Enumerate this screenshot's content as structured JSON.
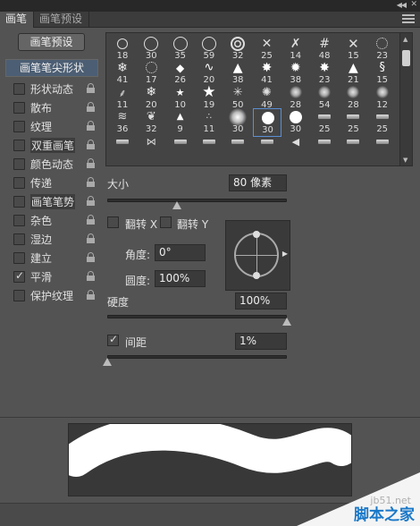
{
  "panel": {
    "tabs": [
      {
        "label": "画笔",
        "active": true
      },
      {
        "label": "画笔预设",
        "active": false
      }
    ],
    "preset_button": "画笔预设"
  },
  "sidebar": {
    "header": "画笔笔尖形状",
    "items": [
      {
        "label": "形状动态",
        "checked": false,
        "locked": true
      },
      {
        "label": "散布",
        "checked": false,
        "locked": true
      },
      {
        "label": "纹理",
        "checked": false,
        "locked": true
      },
      {
        "label": "双重画笔",
        "checked": false,
        "locked": true
      },
      {
        "label": "颜色动态",
        "checked": false,
        "locked": true
      },
      {
        "label": "传递",
        "checked": false,
        "locked": true
      },
      {
        "label": "画笔笔势",
        "checked": false,
        "locked": true
      },
      {
        "label": "杂色",
        "checked": false,
        "locked": true
      },
      {
        "label": "湿边",
        "checked": false,
        "locked": true
      },
      {
        "label": "建立",
        "checked": false,
        "locked": true
      },
      {
        "label": "平滑",
        "checked": true,
        "locked": true
      },
      {
        "label": "保护纹理",
        "checked": false,
        "locked": true
      }
    ]
  },
  "brush_grid": {
    "rows": [
      [
        {
          "size": "18",
          "icon": "ring"
        },
        {
          "size": "30",
          "icon": "ring"
        },
        {
          "size": "35",
          "icon": "ring"
        },
        {
          "size": "59",
          "icon": "ring"
        },
        {
          "size": "32",
          "icon": "double-ring"
        },
        {
          "size": "25",
          "icon": "cross"
        },
        {
          "size": "14",
          "icon": "hatch"
        },
        {
          "size": "48",
          "icon": "grid"
        },
        {
          "size": "15",
          "icon": "x-mark"
        },
        {
          "size": "23",
          "icon": "dotted-ring"
        }
      ],
      [
        {
          "size": "41",
          "icon": "snowflake"
        },
        {
          "size": "17",
          "icon": "dotted-ring"
        },
        {
          "size": "26",
          "icon": "diamond"
        },
        {
          "size": "20",
          "icon": "wave"
        },
        {
          "size": "38",
          "icon": "spike"
        },
        {
          "size": "41",
          "icon": "burst"
        },
        {
          "size": "38",
          "icon": "splat"
        },
        {
          "size": "23",
          "icon": "burst"
        },
        {
          "size": "21",
          "icon": "spike"
        },
        {
          "size": "15",
          "icon": "swirl"
        }
      ],
      [
        {
          "size": "11",
          "icon": "twig"
        },
        {
          "size": "20",
          "icon": "snowflake"
        },
        {
          "size": "10",
          "icon": "star"
        },
        {
          "size": "19",
          "icon": "star"
        },
        {
          "size": "50",
          "icon": "ray"
        },
        {
          "size": "49",
          "icon": "spark"
        },
        {
          "size": "28",
          "icon": "cloud"
        },
        {
          "size": "54",
          "icon": "cloud"
        },
        {
          "size": "28",
          "icon": "cloud"
        },
        {
          "size": "12",
          "icon": "cloud"
        }
      ],
      [
        {
          "size": "36",
          "icon": "streak"
        },
        {
          "size": "32",
          "icon": "leaf"
        },
        {
          "size": "9",
          "icon": "triangle"
        },
        {
          "size": "11",
          "icon": "dots"
        },
        {
          "size": "30",
          "icon": "soft-round"
        },
        {
          "size": "30",
          "icon": "hard-round",
          "selected": true
        },
        {
          "size": "30",
          "icon": "hard-round"
        },
        {
          "size": "25",
          "icon": "bar"
        },
        {
          "size": "25",
          "icon": "bar"
        },
        {
          "size": "25",
          "icon": "bar"
        }
      ],
      [
        {
          "size": "",
          "icon": "bar"
        },
        {
          "size": "",
          "icon": "fan"
        },
        {
          "size": "",
          "icon": "bar"
        },
        {
          "size": "",
          "icon": "bar"
        },
        {
          "size": "",
          "icon": "bar"
        },
        {
          "size": "",
          "icon": "bar"
        },
        {
          "size": "",
          "icon": "cone"
        },
        {
          "size": "",
          "icon": "bar"
        },
        {
          "size": "",
          "icon": "bar"
        },
        {
          "size": "",
          "icon": "bar"
        }
      ]
    ]
  },
  "size": {
    "label": "大小",
    "value": "80 像素",
    "slider_fraction": 0.39
  },
  "flip": {
    "x_label": "翻转 X",
    "y_label": "翻转 Y",
    "x_checked": false,
    "y_checked": false
  },
  "angle": {
    "label": "角度:",
    "value": "0°"
  },
  "roundness": {
    "label": "圆度:",
    "value": "100%"
  },
  "hardness": {
    "label": "硬度",
    "value": "100%",
    "slider_fraction": 1.0
  },
  "spacing": {
    "label": "间距",
    "value": "1%",
    "checked": true,
    "slider_fraction": 0.0
  },
  "watermark": {
    "url": "jb51.net",
    "site": "脚本之家"
  }
}
